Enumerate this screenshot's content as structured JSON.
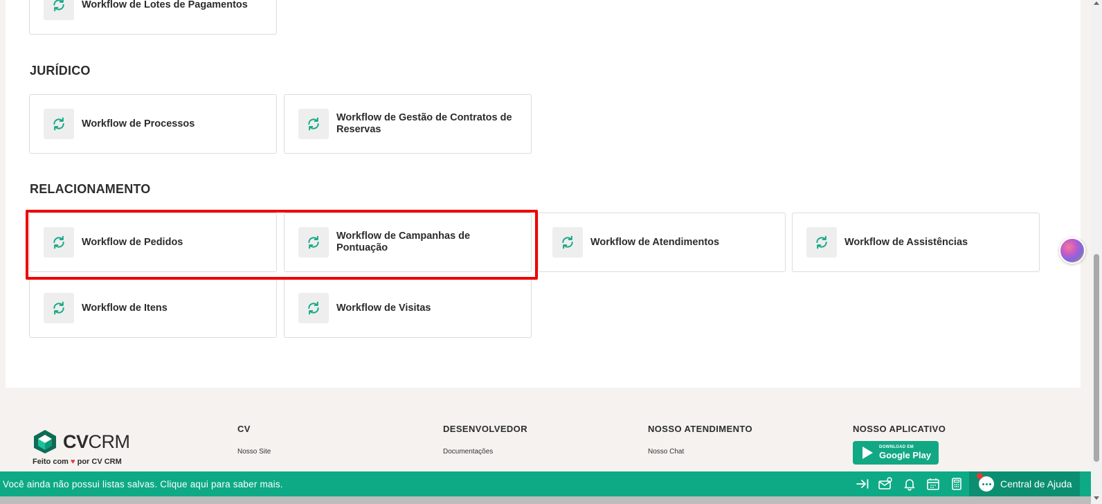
{
  "sections": {
    "top_partial_card": "Workflow de Lotes de Pagamentos",
    "juridico": {
      "title": "JURÍDICO",
      "cards": [
        "Workflow de Processos",
        "Workflow de Gestão de Contratos de Reservas"
      ]
    },
    "relacionamento": {
      "title": "RELACIONAMENTO",
      "cards": [
        "Workflow de Pedidos",
        "Workflow de Campanhas de Pontuação",
        "Workflow de Atendimentos",
        "Workflow de Assistências",
        "Workflow de Itens",
        "Workflow de Visitas"
      ]
    }
  },
  "footer": {
    "brand_bold": "CV",
    "brand_rest": "CRM",
    "made_with_prefix": "Feito com",
    "made_with_heart": "♥",
    "made_with_suffix": "por CV CRM",
    "columns": [
      {
        "heading": "CV",
        "link": "Nosso Site"
      },
      {
        "heading": "DESENVOLVEDOR",
        "link": "Documentações"
      },
      {
        "heading": "NOSSO ATENDIMENTO",
        "link": "Nosso Chat"
      },
      {
        "heading": "NOSSO APLICATIVO",
        "link": ""
      }
    ],
    "google_play_small": "DOWNLOAD EM",
    "google_play_big": "Google Play"
  },
  "bottom_bar": {
    "message": "Você ainda não possui listas salvas. Clique aqui para saber mais.",
    "help_label": "Central de Ajuda",
    "icons": [
      "collapse-arrow-icon",
      "mail-settings-icon",
      "bell-icon",
      "calendar-icon",
      "calculator-icon",
      "chat-icon"
    ]
  },
  "colors": {
    "accent": "#0eaa85",
    "highlight": "#ee0000",
    "icon_green": "#12a884"
  }
}
